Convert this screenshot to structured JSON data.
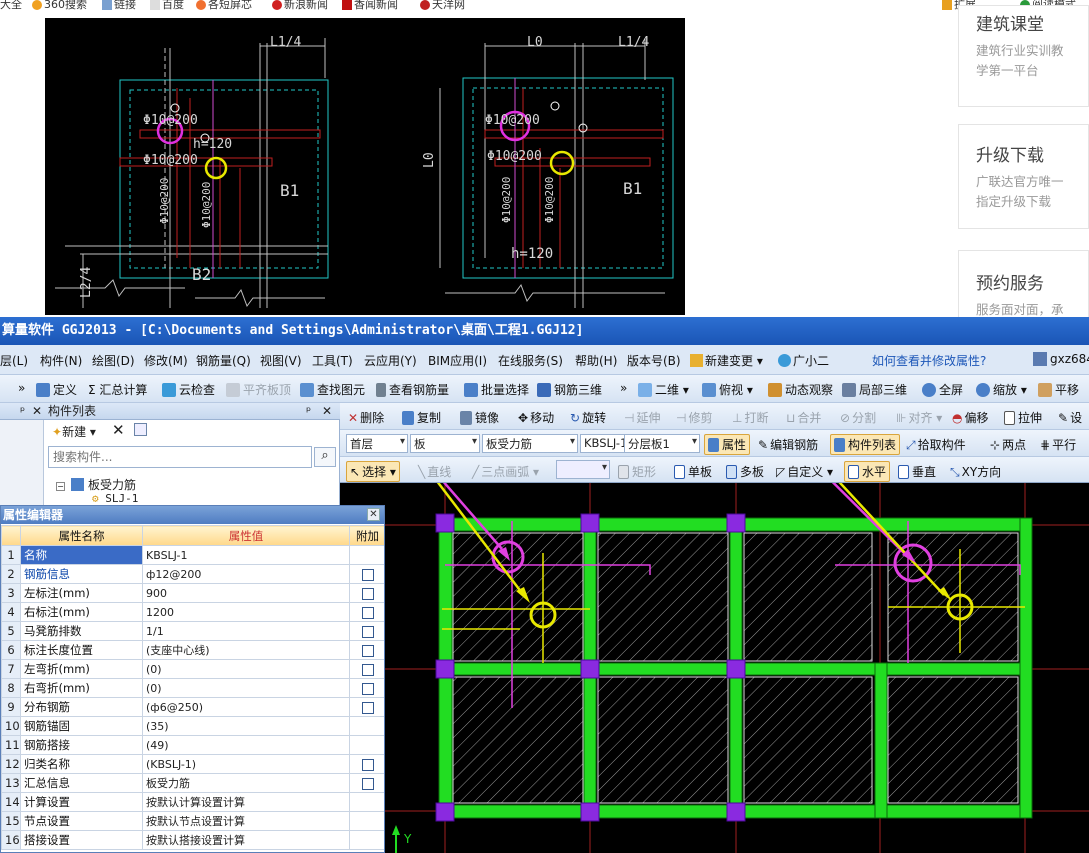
{
  "browser": {
    "bookmarks": [
      "大全",
      "360搜索",
      "链接",
      "百度",
      "各短屏芯",
      "新浪新闻",
      "香闻新闻",
      "天洋网"
    ],
    "right_items": [
      "扩展",
      "阅读模式"
    ]
  },
  "web_cards": [
    {
      "title": "建筑课堂",
      "lines": [
        "建筑行业实训教",
        "学第一平台"
      ]
    },
    {
      "title": "升级下载",
      "lines": [
        "广联达官方唯一",
        "指定升级下载"
      ]
    },
    {
      "title": "预约服务",
      "lines": [
        "服务面对面，承"
      ]
    }
  ],
  "cad_image": {
    "left": {
      "dims": [
        "L1/4",
        "L2/4"
      ],
      "labels": [
        "Φ10@200",
        "h=120",
        "Φ10@200",
        "Φ10@200",
        "Φ10@200",
        "B1",
        "B2"
      ]
    },
    "right": {
      "dims": [
        "L0",
        "L1/4",
        "L0"
      ],
      "labels": [
        "Φ10@200",
        "Φ10@200",
        "Φ10@200",
        "Φ10@200",
        "B1",
        "h=120"
      ]
    }
  },
  "app": {
    "title": "算量软件 GGJ2013 - [C:\\Documents and Settings\\Administrator\\桌面\\工程1.GGJ12]",
    "menu": [
      "层(L)",
      "构件(N)",
      "绘图(D)",
      "修改(M)",
      "钢筋量(Q)",
      "视图(V)",
      "工具(T)",
      "云应用(Y)",
      "BIM应用(I)",
      "在线服务(S)",
      "帮助(H)",
      "版本号(B)",
      "新建变更 ▾",
      "广小二",
      "如何查看并修改属性?",
      "gxz684"
    ],
    "toolbar1": [
      "定义",
      "Σ 汇总计算",
      "云检查",
      "平齐板顶",
      "查找图元",
      "查看钢筋量",
      "批量选择",
      "钢筋三维",
      "二维 ▾",
      "俯视 ▾",
      "动态观察",
      "局部三维",
      "全屏",
      "缩放 ▾",
      "平移"
    ],
    "toolbar2": [
      "删除",
      "复制",
      "镜像",
      "移动",
      "旋转",
      "延伸",
      "修剪",
      "打断",
      "合并",
      "分割",
      "对齐 ▾",
      "偏移",
      "拉伸",
      "设"
    ],
    "toolbar3": {
      "floor": "首层",
      "type": "板",
      "category": "板受力筋",
      "code": "KBSLJ-1",
      "layer": "分层板1",
      "props": "属性",
      "edit_rebar": "编辑钢筋",
      "component_list": "构件列表",
      "pick": "拾取构件",
      "two_points": "两点",
      "parallel": "平行"
    },
    "toolbar4": [
      "选择 ▾",
      "直线",
      "三点画弧 ▾",
      "矩形",
      "单板",
      "多板",
      "自定义 ▾",
      "水平",
      "垂直",
      "XY方向"
    ],
    "component_list": {
      "title": "构件列表",
      "new_button": "新建",
      "search_placeholder": "搜索构件...",
      "tree_root": "板受力筋",
      "tree_child": "SLJ-1"
    },
    "prop_editor": {
      "title": "属性编辑器",
      "headers": [
        "属性名称",
        "属性值",
        "附加"
      ],
      "rows": [
        {
          "n": "1",
          "name": "名称",
          "value": "KBSLJ-1",
          "check": false
        },
        {
          "n": "2",
          "name": "钢筋信息",
          "value": "ф12@200",
          "check": true
        },
        {
          "n": "3",
          "name": "左标注(mm)",
          "value": "900",
          "check": true
        },
        {
          "n": "4",
          "name": "右标注(mm)",
          "value": "1200",
          "check": true
        },
        {
          "n": "5",
          "name": "马凳筋排数",
          "value": "1/1",
          "check": true
        },
        {
          "n": "6",
          "name": "标注长度位置",
          "value": "(支座中心线)",
          "check": true
        },
        {
          "n": "7",
          "name": "左弯折(mm)",
          "value": "(0)",
          "check": true
        },
        {
          "n": "8",
          "name": "右弯折(mm)",
          "value": "(0)",
          "check": true
        },
        {
          "n": "9",
          "name": "分布钢筋",
          "value": "(ф6@250)",
          "check": true
        },
        {
          "n": "10",
          "name": "钢筋锚固",
          "value": "(35)",
          "check": false
        },
        {
          "n": "11",
          "name": "钢筋搭接",
          "value": "(49)",
          "check": false
        },
        {
          "n": "12",
          "name": "归类名称",
          "value": "(KBSLJ-1)",
          "check": true
        },
        {
          "n": "13",
          "name": "汇总信息",
          "value": "板受力筋",
          "check": true
        },
        {
          "n": "14",
          "name": "计算设置",
          "value": "按默认计算设置计算",
          "check": false
        },
        {
          "n": "15",
          "name": "节点设置",
          "value": "按默认节点设置计算",
          "check": false
        },
        {
          "n": "16",
          "name": "搭接设置",
          "value": "按默认搭接设置计算",
          "check": false
        }
      ]
    },
    "axis_label": "Y"
  }
}
